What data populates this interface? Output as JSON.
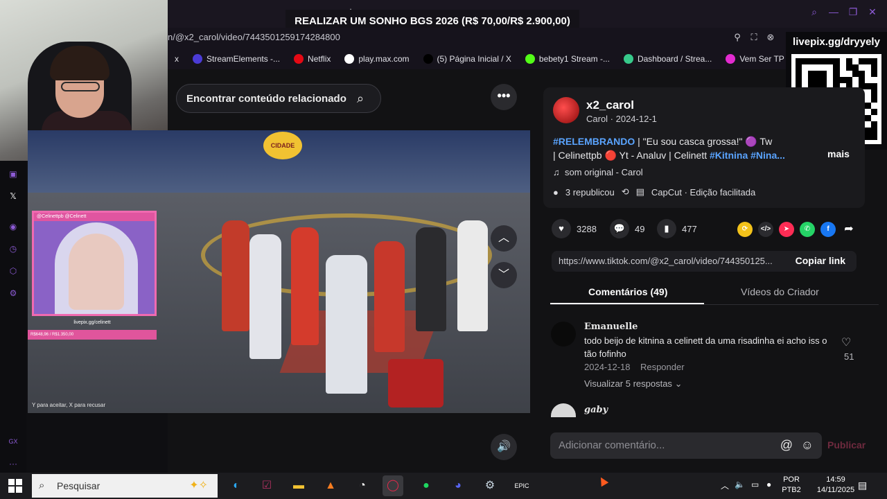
{
  "browser": {
    "url": "n/@x2_carol/video/7443501259174284800",
    "new_tab_icon": "plus-icon",
    "bookmarks": [
      {
        "label": "x",
        "icon": "close-icon",
        "color": "#16131c"
      },
      {
        "label": "StreamElements -...",
        "icon": "streamelements-icon",
        "color": "#4b3bd6"
      },
      {
        "label": "Netflix",
        "icon": "netflix-icon",
        "color": "#e50914"
      },
      {
        "label": "play.max.com",
        "icon": "max-icon",
        "color": "#ffffff"
      },
      {
        "label": "(5) Página Inicial / X",
        "icon": "x-logo-icon",
        "color": "#000000"
      },
      {
        "label": "bebety1 Stream -...",
        "icon": "kick-icon",
        "color": "#53fc18"
      },
      {
        "label": "Dashboard / Strea...",
        "icon": "dashboard-icon",
        "color": "#37c98b"
      },
      {
        "label": "Vem Ser TP",
        "icon": "tp-icon",
        "color": "#e32bd0"
      }
    ]
  },
  "stream": {
    "banner": "REALIZAR UM SONHO BGS 2026 (R$ 70,00/R$ 2.900,00)",
    "qr_label": "livepix.gg/dryyely",
    "pip_top": "@Celinettpb  @Celinett",
    "pip_caption": "livepix.gg/celinett",
    "pip_bar": "R$648,96 / R$1.350,00",
    "game_hint": "Y para aceitar, X para recusar",
    "city_logo": "CIDADE"
  },
  "tiktok": {
    "search_label": "Encontrar conteúdo relacionado",
    "username": "x2_carol",
    "subline": "Carol · 2024-12-1",
    "caption_tag1": "#RELEMBRANDO",
    "caption_text1": " | \"Eu sou casca grossa!\" 🟣 Tw",
    "caption_text2": "| Celinettpb 🔴 Yt - Analuv | Celinett ",
    "caption_tag2": "#Kitnina #Nina...",
    "more_label": "mais",
    "music": "som original - Carol",
    "reposts": "3 republicou",
    "capcut": "CapCut · Edição facilitada",
    "likes": "3288",
    "comments": "49",
    "saves": "477",
    "link": "https://www.tiktok.com/@x2_carol/video/744350125...",
    "copy_label": "Copiar link",
    "tab_comments": "Comentários (49)",
    "tab_videos": "Vídeos do Criador",
    "comment1": {
      "name": "Emanuelle",
      "text": "todo beijo de kitnina a celinett da uma risadinha ei acho iss o tão fofinho",
      "date": "2024-12-18",
      "reply": "Responder",
      "replies": "Visualizar 5 respostas",
      "likes": "51"
    },
    "comment2_name": "gaby",
    "comment_placeholder": "Adicionar comentário...",
    "publish": "Publicar"
  },
  "taskbar": {
    "search_placeholder": "Pesquisar",
    "lang": "POR",
    "lang2": "PTB2",
    "time": "14:59",
    "date": "14/11/2025"
  }
}
